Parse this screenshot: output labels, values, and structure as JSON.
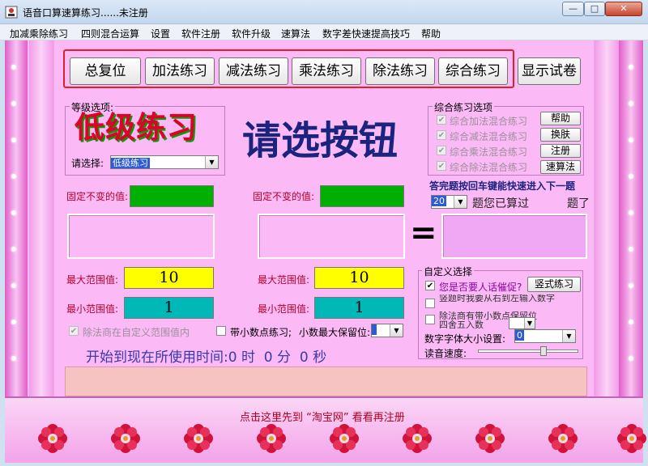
{
  "window": {
    "title": "语音口算速算练习......未注册",
    "controls": {
      "minimize": "—",
      "maximize": "□",
      "close": "✕"
    }
  },
  "menu": [
    "加减乘除练习",
    "四则混合运算",
    "设置",
    "软件注册",
    "软件升级",
    "速算法",
    "数字差快速提高技巧",
    "帮助"
  ],
  "toolbar": {
    "buttons": [
      "总复位",
      "加法练习",
      "减法练习",
      "乘法练习",
      "除法练习",
      "综合练习",
      "显示试卷"
    ]
  },
  "level": {
    "group_title": "等级选项:",
    "level_display": "低级练习",
    "select_label": "请选择:",
    "select_value": "低级练习"
  },
  "prompt": "请选按钮",
  "mixed": {
    "group_title": "综合练习选项",
    "options": [
      "综合加法混合练习",
      "综合减法混合练习",
      "综合乘法混合练习",
      "综合除法混合练习"
    ],
    "side_buttons": [
      "帮助",
      "换肤",
      "注册",
      "速算法"
    ]
  },
  "enter_hint": "答完题按回车键能快速进入下一题",
  "count": {
    "value": "20",
    "label": "题您已算过",
    "suffix": "题了"
  },
  "operand1": {
    "fixed_label": "固定不变的值:",
    "max_label": "最大范围值:",
    "max_value": "10",
    "min_label": "最小范围值:",
    "min_value": "1"
  },
  "operand2": {
    "fixed_label": "固定不变的值:",
    "max_label": "最大范围值:",
    "max_value": "10",
    "min_label": "最小范围值:",
    "min_value": "1"
  },
  "equals": "=",
  "divide_option": "除法商在自定义范围值内",
  "decimal_option": "带小数点练习;",
  "decimal_places_label": "小数最大保留位:",
  "custom": {
    "group_title": "自定义选择",
    "voice_prompt": "您是否要人话催促?",
    "vertical_button": "竖式练习",
    "option2": "竖题时我要从右到左输入数字",
    "option3": "除法商有带小数点保留位四舍五入数",
    "font_size_label": "数字字体大小设置:",
    "font_size_value": "0",
    "speed_label": "读音速度:"
  },
  "timer": {
    "prefix": "开始到现在所使用时间:",
    "hours": "0",
    "h_unit": "时",
    "minutes": "0",
    "m_unit": "分",
    "seconds": "0",
    "s_unit": "秒"
  },
  "footer_link": "点击这里先到 “淘宝网” 看看再注册",
  "colors": {
    "pink": "#fbbaf6",
    "green": "#00b000",
    "yellow": "#ffff00",
    "teal": "#00b8b8",
    "navy": "#1a237e",
    "red": "#e0202a"
  }
}
